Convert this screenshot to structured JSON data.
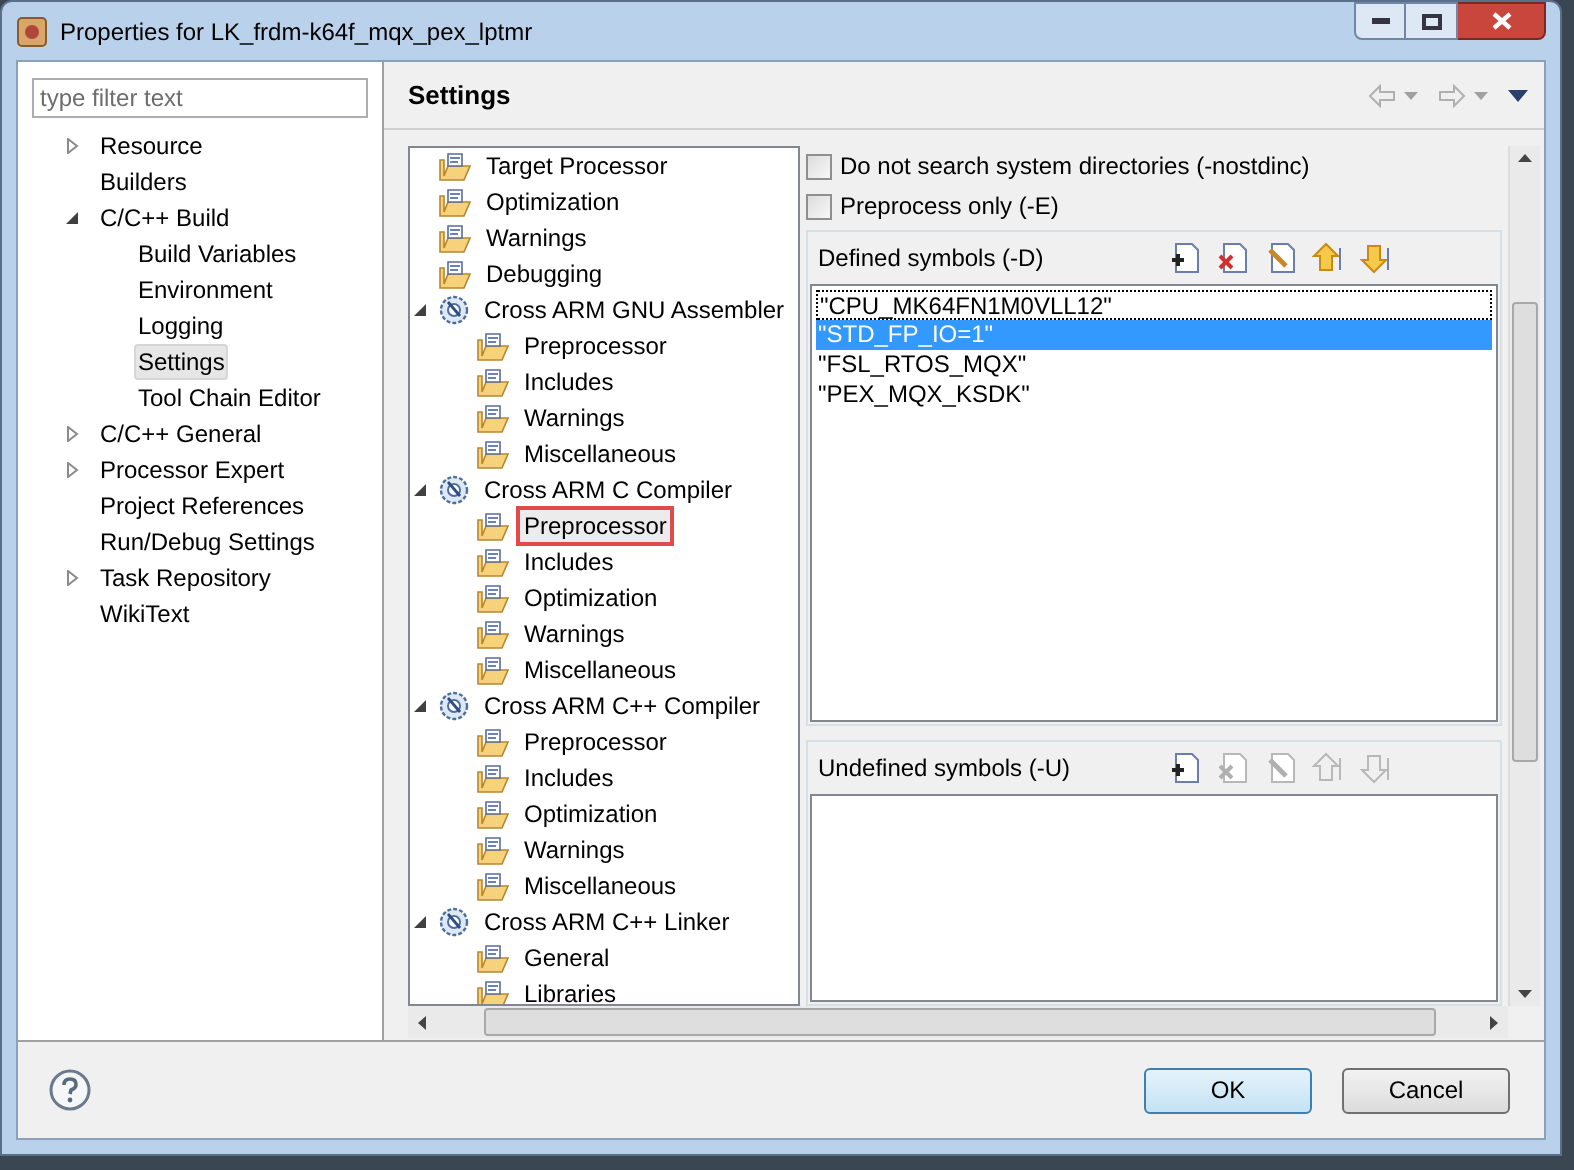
{
  "window": {
    "title": "Properties for LK_frdm-k64f_mqx_pex_lptmr"
  },
  "filter": {
    "placeholder": "type filter text"
  },
  "nav": [
    {
      "label": "Resource",
      "expanded": false,
      "selected": false
    },
    {
      "label": "Builders",
      "selected": false
    },
    {
      "label": "C/C++ Build",
      "expanded": true,
      "selected": false,
      "children": [
        {
          "label": "Build Variables",
          "selected": false
        },
        {
          "label": "Environment",
          "selected": false
        },
        {
          "label": "Logging",
          "selected": false
        },
        {
          "label": "Settings",
          "selected": true
        },
        {
          "label": "Tool Chain Editor",
          "selected": false
        }
      ]
    },
    {
      "label": "C/C++ General",
      "expanded": false,
      "selected": false
    },
    {
      "label": "Processor Expert",
      "expanded": false,
      "selected": false
    },
    {
      "label": "Project References",
      "selected": false
    },
    {
      "label": "Run/Debug Settings",
      "selected": false
    },
    {
      "label": "Task Repository",
      "expanded": false,
      "selected": false
    },
    {
      "label": "WikiText",
      "selected": false
    }
  ],
  "page_title": "Settings",
  "tool_tree": [
    {
      "kind": "category",
      "label": "Target Processor",
      "selected": false
    },
    {
      "kind": "category",
      "label": "Optimization",
      "selected": false
    },
    {
      "kind": "category",
      "label": "Warnings",
      "selected": false
    },
    {
      "kind": "category",
      "label": "Debugging",
      "selected": false
    },
    {
      "kind": "tool",
      "label": "Cross ARM GNU Assembler",
      "expanded": true,
      "selected": false,
      "children": [
        {
          "kind": "category",
          "label": "Preprocessor",
          "selected": false
        },
        {
          "kind": "category",
          "label": "Includes",
          "selected": false
        },
        {
          "kind": "category",
          "label": "Warnings",
          "selected": false
        },
        {
          "kind": "category",
          "label": "Miscellaneous",
          "selected": false
        }
      ]
    },
    {
      "kind": "tool",
      "label": "Cross ARM C Compiler",
      "expanded": true,
      "selected": false,
      "children": [
        {
          "kind": "category",
          "label": "Preprocessor",
          "selected": true
        },
        {
          "kind": "category",
          "label": "Includes",
          "selected": false
        },
        {
          "kind": "category",
          "label": "Optimization",
          "selected": false
        },
        {
          "kind": "category",
          "label": "Warnings",
          "selected": false
        },
        {
          "kind": "category",
          "label": "Miscellaneous",
          "selected": false
        }
      ]
    },
    {
      "kind": "tool",
      "label": "Cross ARM C++ Compiler",
      "expanded": true,
      "selected": false,
      "children": [
        {
          "kind": "category",
          "label": "Preprocessor",
          "selected": false
        },
        {
          "kind": "category",
          "label": "Includes",
          "selected": false
        },
        {
          "kind": "category",
          "label": "Optimization",
          "selected": false
        },
        {
          "kind": "category",
          "label": "Warnings",
          "selected": false
        },
        {
          "kind": "category",
          "label": "Miscellaneous",
          "selected": false
        }
      ]
    },
    {
      "kind": "tool",
      "label": "Cross ARM C++ Linker",
      "expanded": true,
      "selected": false,
      "children": [
        {
          "kind": "category",
          "label": "General",
          "selected": false
        },
        {
          "kind": "category",
          "label": "Libraries",
          "selected": false
        }
      ]
    }
  ],
  "options": [
    {
      "label": "Do not search system directories (-nostdinc)",
      "checked": false
    },
    {
      "label": "Preprocess only (-E)",
      "checked": false
    }
  ],
  "defined_symbols": {
    "title": "Defined symbols (-D)",
    "tools": [
      {
        "kind": "add",
        "disabled": false
      },
      {
        "kind": "delete",
        "disabled": false
      },
      {
        "kind": "edit",
        "disabled": false
      },
      {
        "kind": "up",
        "disabled": false
      },
      {
        "kind": "down",
        "disabled": false
      }
    ],
    "items": [
      {
        "label": "\"CPU_MK64FN1M0VLL12\"",
        "selected": false
      },
      {
        "label": "\"STD_FP_IO=1\"",
        "selected": true
      },
      {
        "label": "\"FSL_RTOS_MQX\"",
        "selected": false
      },
      {
        "label": "\"PEX_MQX_KSDK\"",
        "selected": false
      }
    ]
  },
  "undefined_symbols": {
    "title": "Undefined symbols (-U)",
    "tools": [
      {
        "kind": "add",
        "disabled": false
      },
      {
        "kind": "delete",
        "disabled": true
      },
      {
        "kind": "edit",
        "disabled": true
      },
      {
        "kind": "up",
        "disabled": true
      },
      {
        "kind": "down",
        "disabled": true
      }
    ]
  },
  "buttons": [
    {
      "label": "OK",
      "default": true
    },
    {
      "label": "Cancel",
      "default": false
    }
  ]
}
